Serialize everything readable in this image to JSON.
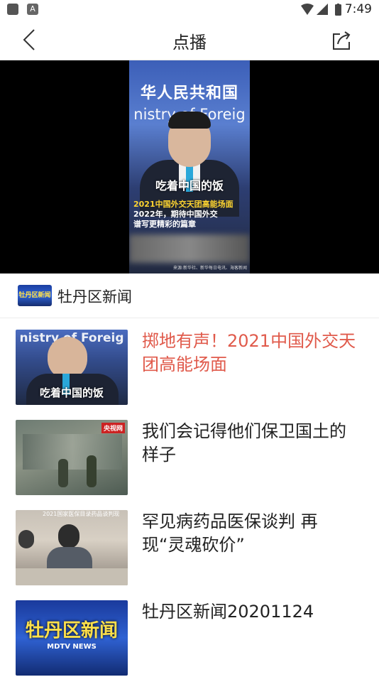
{
  "status_bar": {
    "time": "7:49"
  },
  "header": {
    "title": "点播"
  },
  "video": {
    "banner_cn": "华人民共和国",
    "banner_en": "nistry of Foreig",
    "subtitle": "吃着中国的饭",
    "caption_title": "2021中国外交天团高能场面",
    "caption_line1": "2022年，期待中国外交",
    "caption_line2": "谱写更精彩的篇章",
    "source": "来源:新华社、新华每日电讯、海客新闻"
  },
  "channel": {
    "logo_text": "牡丹区新闻",
    "name": "牡丹区新闻"
  },
  "list": [
    {
      "title": "掷地有声！2021中国外交天团高能场面",
      "thumb_caption": "吃着中国的饭",
      "thumb_banner": "nistry of Foreig",
      "active": true
    },
    {
      "title": "我们会记得他们保卫国土的样子",
      "thumb_badge": "央视网"
    },
    {
      "title": "罕见病药品医保谈判  再现“灵魂砍价”",
      "thumb_banner": "2021国家医保目录药品谈判现"
    },
    {
      "title": "牡丹区新闻20201124",
      "thumb_logo": "牡丹区新闻",
      "thumb_logo_sub": "MDTV NEWS"
    }
  ],
  "colors": {
    "accent": "#e05a4b"
  }
}
